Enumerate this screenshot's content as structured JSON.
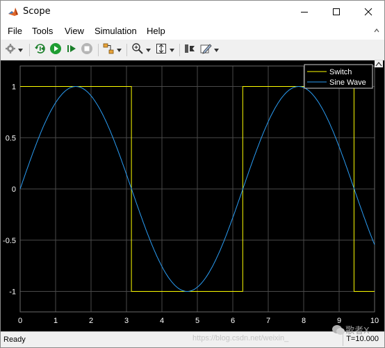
{
  "window": {
    "title": "Scope",
    "minimize_icon": "minimize-icon",
    "maximize_icon": "maximize-icon",
    "close_icon": "close-icon"
  },
  "menu": {
    "items": [
      "File",
      "Tools",
      "View",
      "Simulation",
      "Help"
    ]
  },
  "toolbar": {
    "icons": [
      "settings-icon",
      "step-back-icon",
      "run-icon",
      "step-forward-icon",
      "stop-icon",
      "highlight-icon",
      "zoom-in-icon",
      "autoscale-icon",
      "write-icon",
      "style-icon"
    ]
  },
  "status": {
    "text": "Ready",
    "time": "T=10.000"
  },
  "watermark": {
    "url": "https://blog.csdn.net/weixin_",
    "brand": "歌者X"
  },
  "colors": {
    "switch": "#ffff00",
    "sine": "#2a9df4",
    "grid": "#4a4a4a",
    "axis_text": "#ffffff",
    "background": "#000000"
  },
  "chart_data": {
    "type": "line",
    "xlim": [
      0,
      10
    ],
    "ylim": [
      -1.2,
      1.2
    ],
    "x_ticks": [
      "0",
      "1",
      "2",
      "3",
      "4",
      "5",
      "6",
      "7",
      "8",
      "9",
      "10"
    ],
    "y_ticks": [
      "1",
      "0.5",
      "0",
      "-0.5",
      "-1"
    ],
    "y_tick_values": [
      1,
      0.5,
      0,
      -0.5,
      -1
    ],
    "grid": true,
    "legend_position": "top-right",
    "series": [
      {
        "name": "Switch",
        "x": [
          0,
          3.14,
          3.14,
          6.28,
          6.28,
          9.42,
          9.42,
          10
        ],
        "values": [
          1,
          1,
          -1,
          -1,
          1,
          1,
          -1,
          -1
        ]
      },
      {
        "name": "Sine Wave",
        "function": "sin(x)",
        "x": [
          0,
          0.5,
          1,
          1.57,
          2,
          2.5,
          3,
          3.14,
          3.5,
          4,
          4.71,
          5,
          5.5,
          6,
          6.28,
          7,
          7.85,
          8.5,
          9,
          9.42,
          10
        ],
        "values": [
          0,
          0.479,
          0.841,
          1,
          0.909,
          0.598,
          0.141,
          0,
          -0.351,
          -0.757,
          -1,
          -0.959,
          -0.706,
          -0.279,
          0,
          0.657,
          1,
          0.798,
          0.412,
          0,
          -0.544
        ]
      }
    ]
  }
}
